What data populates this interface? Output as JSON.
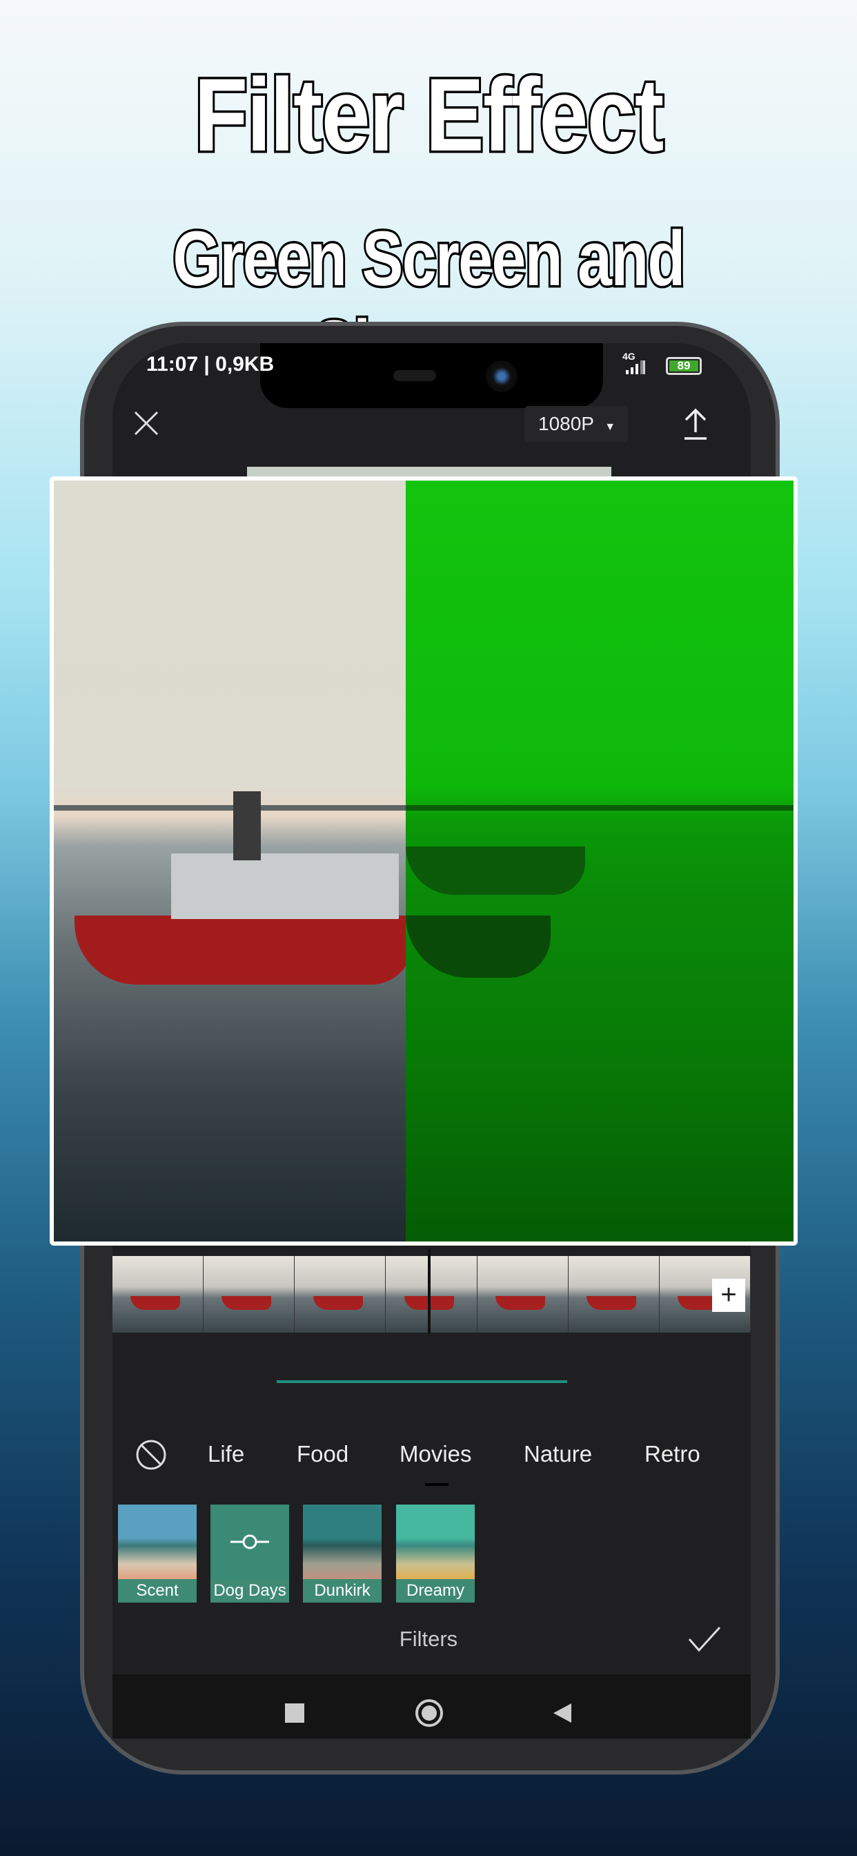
{
  "headline": {
    "title": "Filter Effect",
    "subtitle": "Green Screen and Slowmo"
  },
  "status_bar": {
    "time": "11:07 | 0,9KB",
    "network": "4G",
    "battery": "89"
  },
  "top_bar": {
    "resolution": "1080P",
    "close_icon": "close-icon",
    "export_icon": "upload-icon"
  },
  "timeline": {
    "add_label": "+"
  },
  "categories": {
    "none_icon": "no-filter-icon",
    "items": [
      "Life",
      "Food",
      "Movies",
      "Nature",
      "Retro"
    ],
    "selected": "Movies"
  },
  "filters": [
    {
      "label": "Scent"
    },
    {
      "label": "Dog Days",
      "selected": true
    },
    {
      "label": "Dunkirk"
    },
    {
      "label": "Dreamy"
    }
  ],
  "panel": {
    "title": "Filters"
  },
  "colors": {
    "accent": "#3e8a72",
    "progress": "#1f8f80",
    "green_screen": "#12c00e"
  }
}
